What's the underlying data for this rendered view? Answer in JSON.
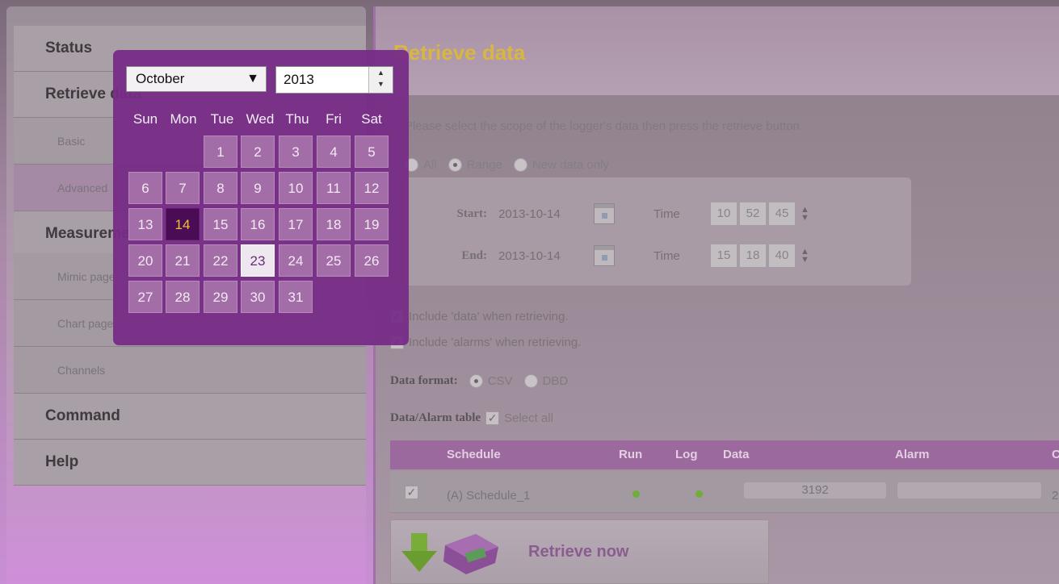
{
  "sidebar": {
    "items": [
      {
        "label": "Status",
        "type": "head"
      },
      {
        "label": "Retrieve data",
        "type": "head"
      },
      {
        "label": "Basic",
        "type": "sub"
      },
      {
        "label": "Advanced",
        "type": "sub",
        "active": true
      },
      {
        "label": "Measurement",
        "type": "head"
      },
      {
        "label": "Mimic page",
        "type": "sub"
      },
      {
        "label": "Chart page",
        "type": "sub"
      },
      {
        "label": "Channels",
        "type": "sub"
      },
      {
        "label": "Command",
        "type": "head"
      },
      {
        "label": "Help",
        "type": "head"
      }
    ]
  },
  "main": {
    "title": "Retrieve data",
    "instructions": "Please select the scope of the logger's data then press the retrieve button.",
    "scope": {
      "options": [
        "All",
        "Range",
        "New data only"
      ],
      "selected": "Range"
    },
    "range": {
      "start_label": "Start:",
      "start_date": "2013-10-14",
      "start_time": [
        "10",
        "52",
        "45"
      ],
      "end_label": "End:",
      "end_date": "2013-10-14",
      "end_time": [
        "15",
        "18",
        "40"
      ],
      "time_label": "Time"
    },
    "include_data": "Include 'data' when retrieving.",
    "include_alarms": "Include 'alarms' when retrieving.",
    "format": {
      "label": "Data format:",
      "options": [
        "CSV",
        "DBD"
      ],
      "selected": "CSV"
    },
    "table_label": "Data/Alarm table",
    "select_all": "Select all",
    "table": {
      "headers": [
        "Schedule",
        "Run",
        "Log",
        "Data",
        "Alarm",
        "C"
      ],
      "rows": [
        {
          "schedule": "(A) Schedule_1",
          "data": "3192",
          "alarm": "",
          "extra": "2"
        }
      ]
    },
    "retrieve_button": "Retrieve now"
  },
  "datepicker": {
    "month": "October",
    "year": "2013",
    "weekdays": [
      "Sun",
      "Mon",
      "Tue",
      "Wed",
      "Thu",
      "Fri",
      "Sat"
    ],
    "days": [
      "1",
      "2",
      "3",
      "4",
      "5",
      "6",
      "7",
      "8",
      "9",
      "10",
      "11",
      "12",
      "13",
      "14",
      "15",
      "16",
      "17",
      "18",
      "19",
      "20",
      "21",
      "22",
      "23",
      "24",
      "25",
      "26",
      "27",
      "28",
      "29",
      "30",
      "31"
    ],
    "first_weekday_index": 2,
    "selected_day": "14",
    "hover_day": "23"
  },
  "colors": {
    "accent_purple": "#762c86",
    "title_gold": "#d9b640",
    "status_green": "#6fae3a"
  }
}
